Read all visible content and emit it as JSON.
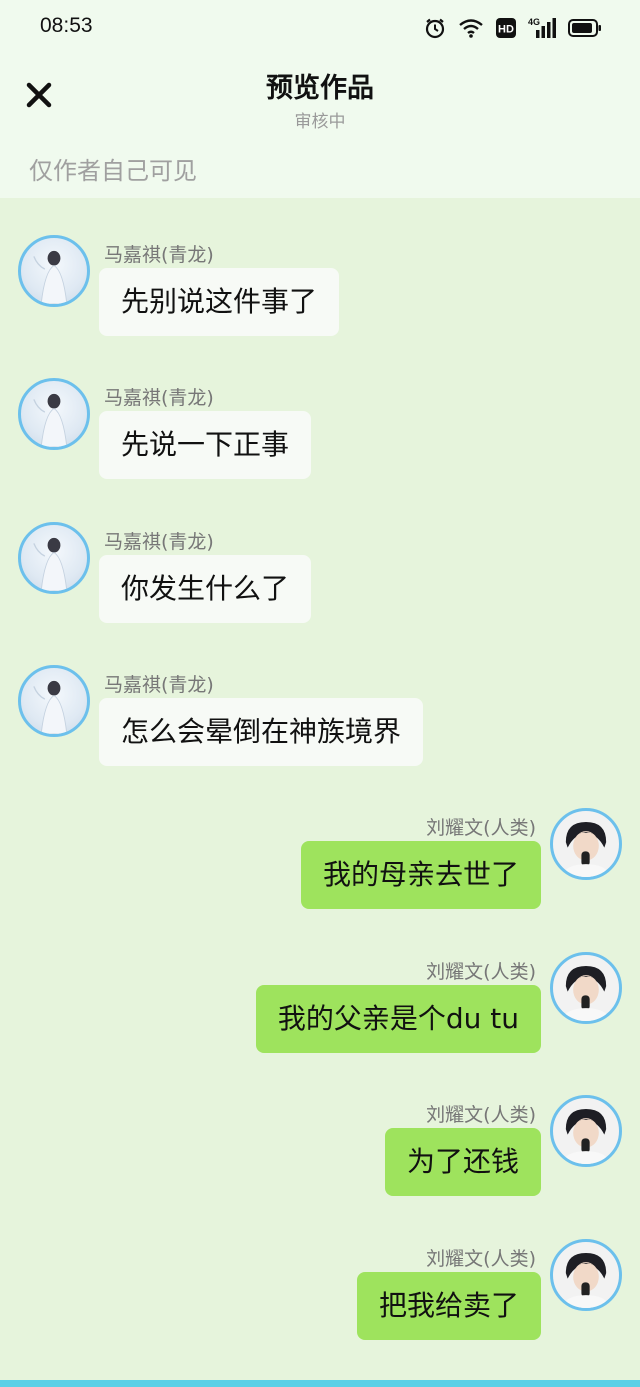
{
  "status_bar": {
    "time": "08:53",
    "icons": [
      "alarm-icon",
      "wifi-icon",
      "hd-icon",
      "signal-4g-icon",
      "battery-icon"
    ],
    "hd_label": "HD",
    "network_label": "4G"
  },
  "header": {
    "close_icon": "close-icon",
    "title": "预览作品",
    "subtitle": "审核中",
    "visibility_note": "仅作者自己可见"
  },
  "colors": {
    "header_bg": "#f0faee",
    "chat_bg": "#e6f4dc",
    "left_bubble": "#f7faf6",
    "right_bubble": "#9ee35d",
    "avatar_border": "#6cc0ec"
  },
  "messages": [
    {
      "side": "left",
      "sender": "马嘉祺(青龙)",
      "text": "先别说这件事了"
    },
    {
      "side": "left",
      "sender": "马嘉祺(青龙)",
      "text": "先说一下正事"
    },
    {
      "side": "left",
      "sender": "马嘉祺(青龙)",
      "text": "你发生什么了"
    },
    {
      "side": "left",
      "sender": "马嘉祺(青龙)",
      "text": "怎么会晕倒在神族境界"
    },
    {
      "side": "right",
      "sender": "刘耀文(人类)",
      "text": "我的母亲去世了"
    },
    {
      "side": "right",
      "sender": "刘耀文(人类)",
      "text": "我的父亲是个du tu"
    },
    {
      "side": "right",
      "sender": "刘耀文(人类)",
      "text": "为了还钱"
    },
    {
      "side": "right",
      "sender": "刘耀文(人类)",
      "text": "把我给卖了"
    }
  ]
}
